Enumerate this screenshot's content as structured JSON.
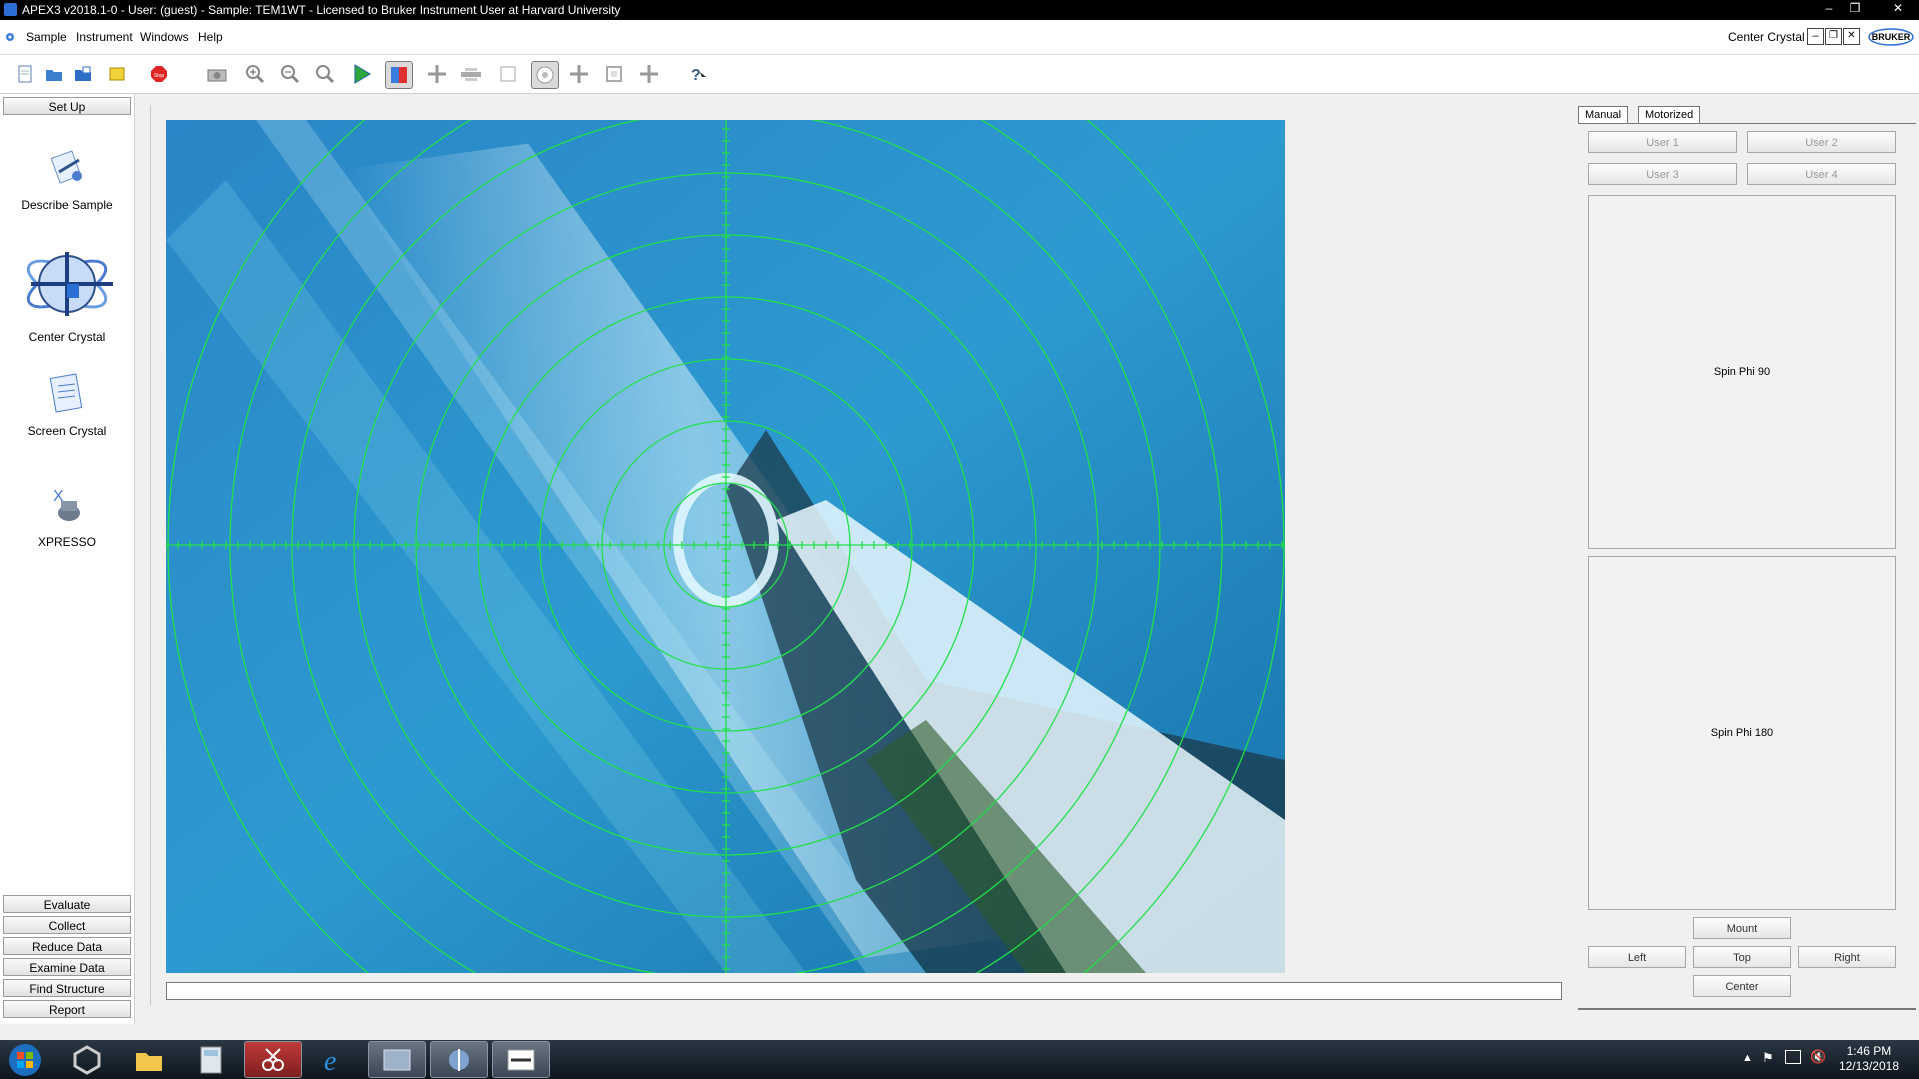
{
  "window": {
    "title": "APEX3 v2018.1-0 - User: (guest) - Sample: TEM1WT - Licensed to Bruker Instrument User at Harvard University",
    "controls": [
      "–",
      "❐",
      "✕"
    ]
  },
  "menubar": {
    "items": [
      "Sample",
      "Instrument",
      "Windows",
      "Help"
    ],
    "right_label": "Center Crystal",
    "logo_text": "BRUKER"
  },
  "toolbar": {
    "icons": [
      "new-document-icon",
      "open-folder-icon",
      "save-icon",
      "note-icon",
      "stop-icon",
      "camera-icon",
      "zoom-in-icon",
      "zoom-out-icon",
      "zoom-reset-icon",
      "play-icon",
      "color-toggle-icon",
      "crosshair-icon",
      "minus-icon",
      "square-icon",
      "target-circle-icon",
      "crosshair-icon",
      "rectangle-icon",
      "crosshair-icon",
      "help-icon"
    ],
    "stop_label": "Stop"
  },
  "sidebar": {
    "setup_label": "Set Up",
    "functions": [
      {
        "label": "Describe Sample",
        "icon": "describe-sample-icon"
      },
      {
        "label": "Center Crystal",
        "icon": "center-crystal-icon"
      },
      {
        "label": "Screen Crystal",
        "icon": "screen-crystal-icon"
      },
      {
        "label": "XPRESSO",
        "icon": "xpresso-icon"
      }
    ],
    "bottom_buttons": [
      "Evaluate",
      "Collect",
      "Reduce Data",
      "Examine Data",
      "Find Structure",
      "Report"
    ]
  },
  "camera": {
    "overlay_color": "#22e04a",
    "ring_count": 9
  },
  "right_panel": {
    "tabs": [
      "Manual",
      "Motorized"
    ],
    "user_buttons": [
      "User 1",
      "User 2",
      "User 3",
      "User 4"
    ],
    "spin_buttons": [
      "Spin Phi 90",
      "Spin Phi 180"
    ],
    "position_buttons": {
      "mount": "Mount",
      "left": "Left",
      "top": "Top",
      "right": "Right",
      "center": "Center"
    }
  },
  "taskbar": {
    "time": "1:46 PM",
    "date": "12/13/2018"
  }
}
